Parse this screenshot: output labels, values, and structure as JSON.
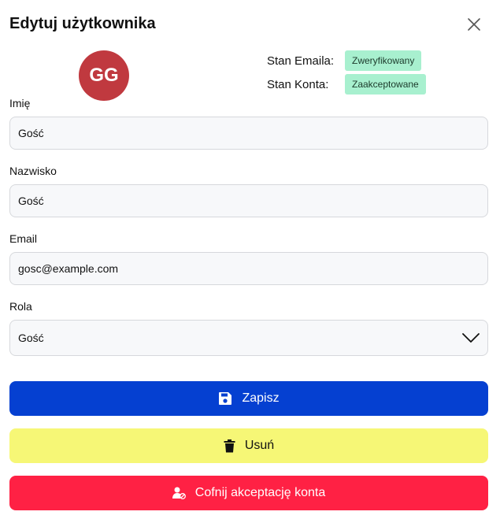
{
  "header": {
    "title": "Edytuj użytkownika",
    "close_icon": "close-icon"
  },
  "avatar": {
    "initials": "GG",
    "color": "#c0393f"
  },
  "status": {
    "email_label": "Stan Emaila:",
    "email_value": "Zweryfikowany",
    "account_label": "Stan Konta:",
    "account_value": "Zaakceptowane",
    "badge_color": "#a8f0cf"
  },
  "form": {
    "first_name": {
      "label": "Imię",
      "value": "Gość"
    },
    "last_name": {
      "label": "Nazwisko",
      "value": "Gość"
    },
    "email": {
      "label": "Email",
      "value": "gosc@example.com"
    },
    "role": {
      "label": "Rola",
      "value": "Gość",
      "icon": "chevron-down-icon"
    }
  },
  "actions": {
    "save": {
      "label": "Zapisz",
      "icon": "save-icon",
      "color": "#0540d1"
    },
    "delete": {
      "label": "Usuń",
      "icon": "trash-icon",
      "color": "#f6f776"
    },
    "revoke": {
      "label": "Cofnij akceptację konta",
      "icon": "user-revoke-icon",
      "color": "#ff2144"
    }
  }
}
